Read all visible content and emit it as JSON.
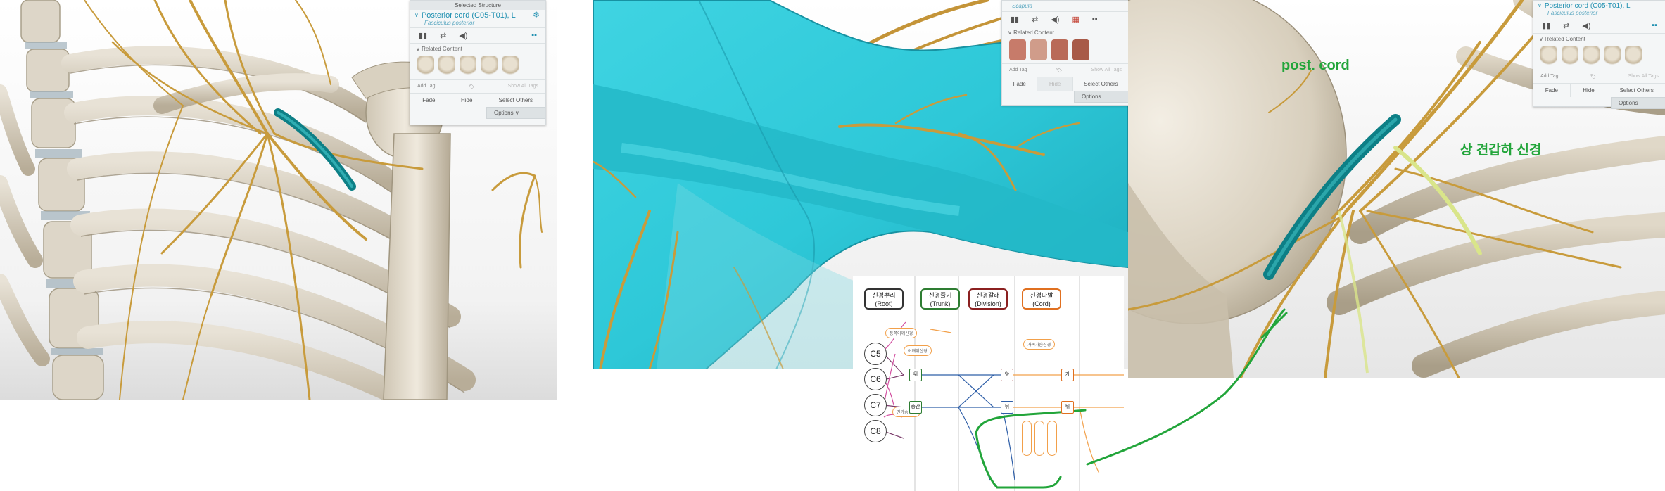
{
  "panel1": {
    "header": "Selected Structure",
    "title": "Posterior cord (C05-T01), L",
    "subtitle": "Fasciculus posterior",
    "related": "Related Content",
    "add_tag": "Add Tag",
    "show_tags": "Show All Tags",
    "fade": "Fade",
    "hide": "Hide",
    "select_others": "Select Others",
    "options": "Options"
  },
  "panel2": {
    "subtitle": "Scapula",
    "related": "Related Content",
    "add_tag": "Add Tag",
    "show_tags": "Show All Tags",
    "fade": "Fade",
    "hide": "Hide",
    "select_others": "Select Others",
    "options": "Options"
  },
  "panel3": {
    "title": "Posterior cord (C05-T01), L",
    "subtitle": "Fasciculus posterior",
    "related": "Related Content",
    "add_tag": "Add Tag",
    "show_tags": "Show All Tags",
    "fade": "Fade",
    "hide": "Hide",
    "select_others": "Select Others",
    "options": "Options"
  },
  "annotations": {
    "post_cord": "post. cord",
    "nerve": "상 견갑하 신경"
  },
  "diagram": {
    "headers": [
      {
        "ko": "신경뿌리",
        "en": "(Root)",
        "color": "#333333"
      },
      {
        "ko": "신경줄기",
        "en": "(Trunk)",
        "color": "#2e7d32"
      },
      {
        "ko": "신경갈래",
        "en": "(Division)",
        "color": "#8b2020"
      },
      {
        "ko": "신경다발",
        "en": "(Cord)",
        "color": "#e07020"
      }
    ],
    "roots": [
      "C5",
      "C6",
      "C7",
      "C8"
    ],
    "tags": {
      "t1": "등쪽어깨신경",
      "t2": "어깨위신경",
      "t3": "가쪽가슴신경",
      "t4": "긴가슴신경"
    },
    "nodes": {
      "upper": "위",
      "middle": "중간",
      "front1": "앞",
      "back": "뒤",
      "lat": "가",
      "post": "뒤"
    }
  }
}
